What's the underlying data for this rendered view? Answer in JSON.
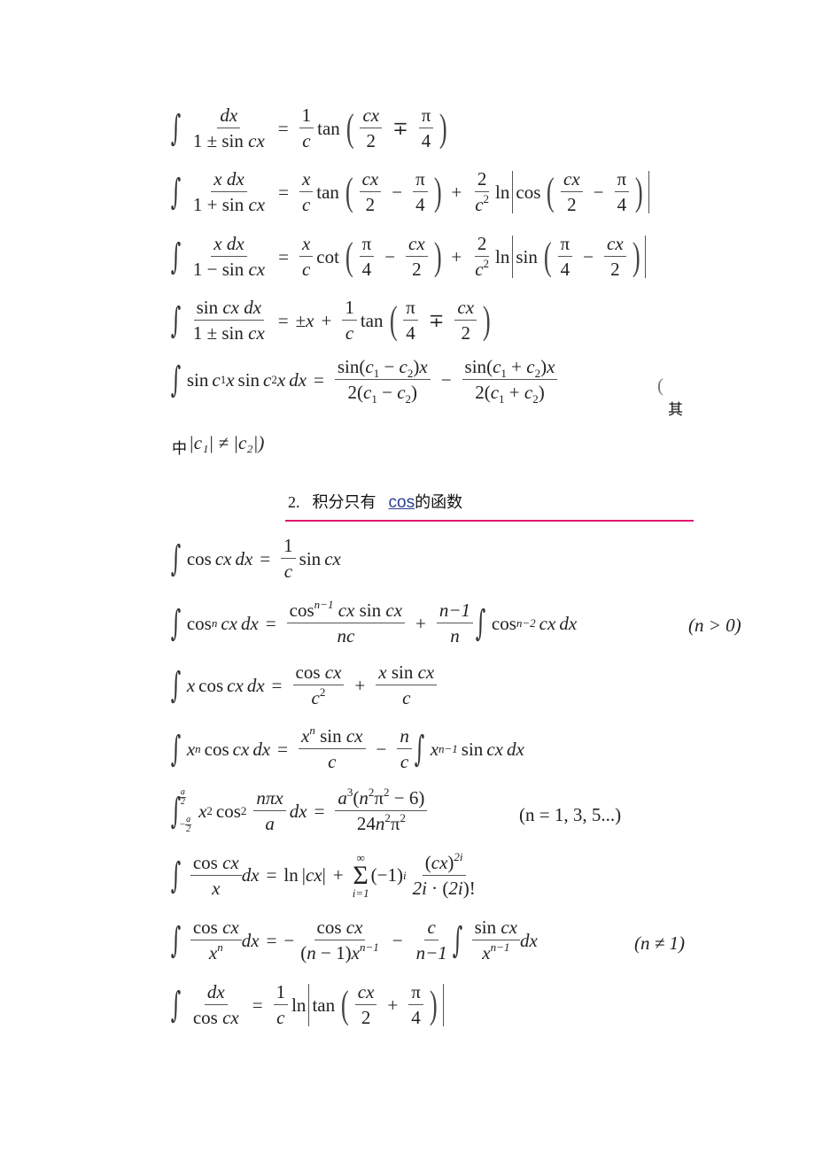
{
  "colors": {
    "rule": "#e0166e",
    "link": "#2a3f97",
    "text": "#222222"
  },
  "section1_formulas": [
    {
      "id": "f1",
      "label": "∫ dx/(1 ± sin cx) = (1/c) tan(cx/2 ∓ π/4)"
    },
    {
      "id": "f2",
      "label": "∫ x dx/(1 + sin cx) = (x/c) tan(cx/2 − π/4) + (2/c²) ln|cos(cx/2 − π/4)|"
    },
    {
      "id": "f3",
      "label": "∫ x dx/(1 − sin cx) = (x/c) cot(π/4 − cx/2) + (2/c²) ln|sin(π/4 − cx/2)|"
    },
    {
      "id": "f4",
      "label": "∫ sin cx dx/(1 ± sin cx) = ±x + (1/c) tan(π/4 ∓ cx/2)"
    },
    {
      "id": "f5",
      "label": "∫ sin c1x sin c2x dx = sin(c1 − c2)x/(2(c1 − c2)) − sin(c1 + c2)x/(2(c1 + c2))"
    }
  ],
  "f5_note": {
    "open": "(",
    "cjk_1": "其",
    "cjk_2": "中",
    "condition_tail": "|c₁| ≠ |c₂|)"
  },
  "heading": {
    "number": "2.",
    "text_before": "积分只有",
    "link": "cos ",
    "text_after": "的函数"
  },
  "section2_formulas": [
    {
      "id": "g1",
      "label": "∫ cos cx dx = (1/c) sin cx"
    },
    {
      "id": "g2",
      "label": "∫ cosⁿ cx dx = cosⁿ⁻¹ cx sin cx/(nc) + ((n−1)/n) ∫ cosⁿ⁻² cx dx",
      "condition": "(n > 0)"
    },
    {
      "id": "g3",
      "label": "∫ x cos cx dx = cos cx/c² + x sin cx/c"
    },
    {
      "id": "g4",
      "label": "∫ xⁿ cos cx dx = xⁿ sin cx/c − (n/c) ∫ xⁿ⁻¹ sin cx dx"
    },
    {
      "id": "g5",
      "label": "∫_{−a/2}^{a/2} x² cos² (nπx/a) dx = a³(n²π² − 6)/(24n²π²)",
      "condition": "(n = 1, 3, 5...)"
    },
    {
      "id": "g6",
      "label": "∫ (cos cx/x) dx = ln|cx| + Σ_{i=1}^{∞} (−1)^i (cx)^{2i}/(2i·(2i)!)"
    },
    {
      "id": "g7",
      "label": "∫ (cos cx/xⁿ) dx = −cos cx/((n−1)xⁿ⁻¹) − (c/(n−1)) ∫ (sin cx/xⁿ⁻¹) dx",
      "condition": "(n ≠ 1)"
    },
    {
      "id": "g8",
      "label": "∫ dx/cos cx = (1/c) ln|tan(cx/2 + π/4)|"
    }
  ],
  "sym": {
    "int": "∫",
    "eq": "=",
    "plus": "+",
    "minus": "−",
    "pm": "±",
    "mp": "∓",
    "pi": "π",
    "lp": "(",
    "rp": ")",
    "one": "1",
    "two": "2",
    "four": "4",
    "c": "c",
    "x": "x",
    "dx": "dx",
    "cx": "cx",
    "tan": "tan",
    "cot": "cot",
    "sin": "sin",
    "cos": "cos",
    "ln": "ln",
    "c2sup": "2",
    "n": "n",
    "nm1": "n−1",
    "nm2": "n−2",
    "inf": "∞",
    "ieq1": "i=1",
    "neq": "≠",
    "sigma": "Σ",
    "a": "a",
    "three": "3",
    "i": "i",
    "twoi": "2i"
  }
}
